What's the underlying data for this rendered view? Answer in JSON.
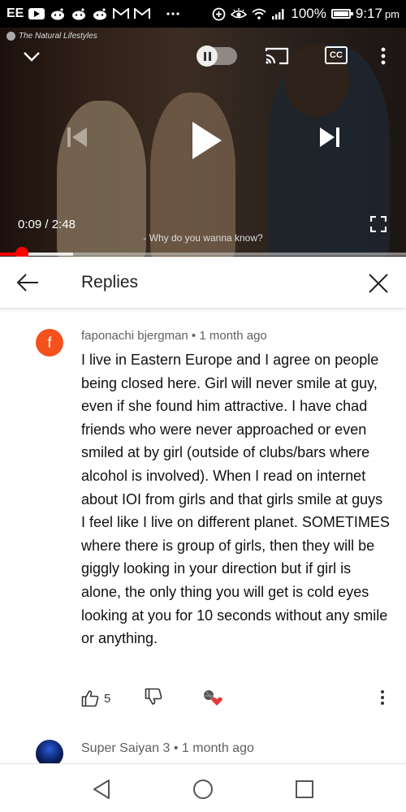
{
  "status_bar": {
    "carrier": "EE",
    "battery": "100%",
    "battery_level": 1.0,
    "time": "9:17",
    "time_suffix": "pm",
    "notification_icons": [
      "youtube-icon",
      "reddit-icon",
      "reddit-icon",
      "reddit-icon",
      "gmail-icon",
      "gmail-icon",
      "more-notifications-icon"
    ],
    "system_icons": [
      "data-saver-icon",
      "eye-comfort-icon",
      "wifi-icon",
      "signal-icon",
      "battery-icon"
    ]
  },
  "video": {
    "watermark": "The Natural Lifestyles",
    "current_time": "0:09",
    "duration": "2:48",
    "subtitle": "- Why do you wanna know?",
    "played_fraction": 0.054,
    "buffered_fraction": 0.18,
    "controls": {
      "cc_label": "CC"
    }
  },
  "replies_header": {
    "title": "Replies"
  },
  "comment": {
    "avatar_letter": "f",
    "avatar_color": "#f4511e",
    "author": "faponachi bjergman",
    "age": "1 month ago",
    "text": "I live in Eastern Europe and I agree on people being closed here. Girl will never smile at guy, even if she found him attractive. I have chad friends who were never approached or even smiled at by girl (outside of clubs/bars where alcohol is involved). When I read on internet about IOI from girls and that girls smile at guys I feel like I live on different planet. SOMETIMES where there is group of girls, then they will be giggly looking in your direction but if girl is alone, the only thing you will get is cold eyes looking at you for 10 seconds without any smile or anything.",
    "likes": "5"
  },
  "next_reply": {
    "author": "Super Saiyan 3",
    "age": "1 month ago"
  },
  "colors": {
    "accent_red": "#ff0000",
    "text_primary": "#212121",
    "text_secondary": "#606060"
  }
}
